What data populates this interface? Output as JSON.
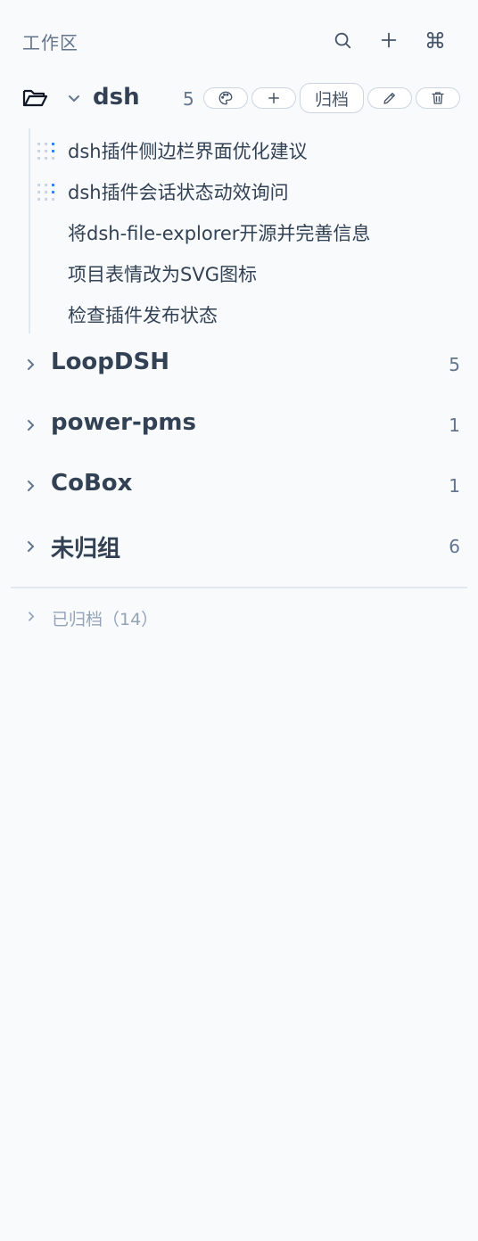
{
  "header": {
    "title": "工作区",
    "icons": [
      "search-icon",
      "plus-icon",
      "command-icon"
    ]
  },
  "active_group": {
    "name": "dsh",
    "count": "5",
    "actions": {
      "archive_label": "归档",
      "icons": [
        "palette-icon",
        "plus-icon",
        "pencil-icon",
        "trash-icon"
      ]
    },
    "sessions": [
      {
        "label": "dsh插件侧边栏界面优化建议",
        "has_handle": true
      },
      {
        "label": "dsh插件会话状态动效询问",
        "has_handle": true
      },
      {
        "label": "将dsh-file-explorer开源并完善信息",
        "has_handle": false
      },
      {
        "label": "项目表情改为SVG图标",
        "has_handle": false
      },
      {
        "label": "检查插件发布状态",
        "has_handle": false
      }
    ]
  },
  "groups": [
    {
      "name": "LoopDSH",
      "count": "5"
    },
    {
      "name": "power-pms",
      "count": "1"
    },
    {
      "name": "CoBox",
      "count": "1"
    },
    {
      "name": "未归组",
      "count": "6"
    }
  ],
  "archived": {
    "label": "已归档（14）"
  },
  "colors": {
    "background": "#f8fafc",
    "text": "#334155",
    "muted": "#64748b",
    "handle_dot": "#3b82f6"
  }
}
